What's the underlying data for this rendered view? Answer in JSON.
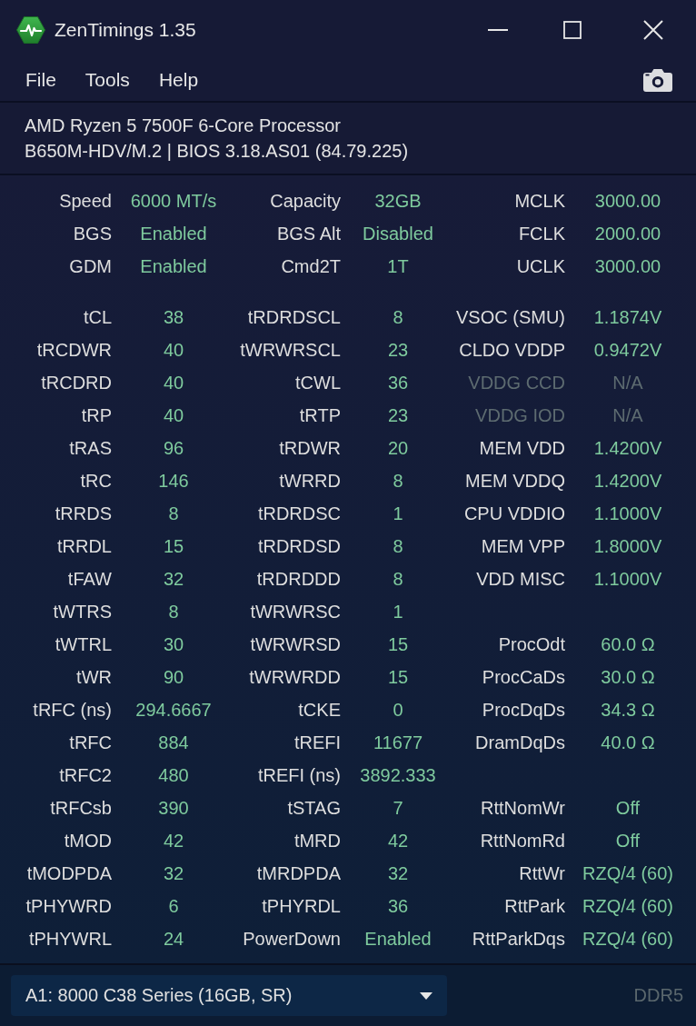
{
  "window": {
    "title": "ZenTimings 1.35"
  },
  "menu": [
    "File",
    "Tools",
    "Help"
  ],
  "system_info": {
    "processor": "AMD Ryzen 5 7500F 6-Core Processor",
    "board": "B650M-HDV/M.2 | BIOS 3.18.AS01 (84.79.225)"
  },
  "summary": {
    "columns": [
      {
        "items": [
          {
            "label": "Speed",
            "value": "6000 MT/s"
          },
          {
            "label": "BGS",
            "value": "Enabled"
          },
          {
            "label": "GDM",
            "value": "Enabled"
          }
        ]
      },
      {
        "items": [
          {
            "label": "Capacity",
            "value": "32GB"
          },
          {
            "label": "BGS Alt",
            "value": "Disabled"
          },
          {
            "label": "Cmd2T",
            "value": "1T"
          }
        ]
      },
      {
        "items": [
          {
            "label": "MCLK",
            "value": "3000.00"
          },
          {
            "label": "FCLK",
            "value": "2000.00"
          },
          {
            "label": "UCLK",
            "value": "3000.00"
          }
        ]
      }
    ]
  },
  "timings": {
    "columns": [
      {
        "groups": [
          {
            "items": [
              {
                "label": "tCL",
                "value": "38",
                "disabled": false
              },
              {
                "label": "tRCDWR",
                "value": "40",
                "disabled": false
              },
              {
                "label": "tRCDRD",
                "value": "40",
                "disabled": false
              },
              {
                "label": "tRP",
                "value": "40",
                "disabled": false
              },
              {
                "label": "tRAS",
                "value": "96",
                "disabled": false
              },
              {
                "label": "tRC",
                "value": "146",
                "disabled": false
              },
              {
                "label": "tRRDS",
                "value": "8",
                "disabled": false
              },
              {
                "label": "tRRDL",
                "value": "15",
                "disabled": false
              },
              {
                "label": "tFAW",
                "value": "32",
                "disabled": false
              },
              {
                "label": "tWTRS",
                "value": "8",
                "disabled": false
              },
              {
                "label": "tWTRL",
                "value": "30",
                "disabled": false
              },
              {
                "label": "tWR",
                "value": "90",
                "disabled": false
              },
              {
                "label": "tRFC (ns)",
                "value": "294.6667",
                "disabled": false
              },
              {
                "label": "tRFC",
                "value": "884",
                "disabled": false
              },
              {
                "label": "tRFC2",
                "value": "480",
                "disabled": false
              },
              {
                "label": "tRFCsb",
                "value": "390",
                "disabled": false
              },
              {
                "label": "tMOD",
                "value": "42",
                "disabled": false
              },
              {
                "label": "tMODPDA",
                "value": "32",
                "disabled": false
              },
              {
                "label": "tPHYWRD",
                "value": "6",
                "disabled": false
              },
              {
                "label": "tPHYWRL",
                "value": "24",
                "disabled": false
              }
            ]
          }
        ]
      },
      {
        "groups": [
          {
            "items": [
              {
                "label": "tRDRDSCL",
                "value": "8",
                "disabled": false
              },
              {
                "label": "tWRWRSCL",
                "value": "23",
                "disabled": false
              },
              {
                "label": "tCWL",
                "value": "36",
                "disabled": false
              },
              {
                "label": "tRTP",
                "value": "23",
                "disabled": false
              },
              {
                "label": "tRDWR",
                "value": "20",
                "disabled": false
              },
              {
                "label": "tWRRD",
                "value": "8",
                "disabled": false
              },
              {
                "label": "tRDRDSC",
                "value": "1",
                "disabled": false
              },
              {
                "label": "tRDRDSD",
                "value": "8",
                "disabled": false
              },
              {
                "label": "tRDRDDD",
                "value": "8",
                "disabled": false
              },
              {
                "label": "tWRWRSC",
                "value": "1",
                "disabled": false
              },
              {
                "label": "tWRWRSD",
                "value": "15",
                "disabled": false
              },
              {
                "label": "tWRWRDD",
                "value": "15",
                "disabled": false
              },
              {
                "label": "tCKE",
                "value": "0",
                "disabled": false
              },
              {
                "label": "tREFI",
                "value": "11677",
                "disabled": false
              },
              {
                "label": "tREFI (ns)",
                "value": "3892.333",
                "disabled": false
              },
              {
                "label": "tSTAG",
                "value": "7",
                "disabled": false
              },
              {
                "label": "tMRD",
                "value": "42",
                "disabled": false
              },
              {
                "label": "tMRDPDA",
                "value": "32",
                "disabled": false
              },
              {
                "label": "tPHYRDL",
                "value": "36",
                "disabled": false
              },
              {
                "label": "PowerDown",
                "value": "Enabled",
                "disabled": false
              }
            ]
          }
        ]
      },
      {
        "groups": [
          {
            "items": [
              {
                "label": "VSOC (SMU)",
                "value": "1.1874V",
                "disabled": false
              },
              {
                "label": "CLDO VDDP",
                "value": "0.9472V",
                "disabled": false
              },
              {
                "label": "VDDG CCD",
                "value": "N/A",
                "disabled": true
              },
              {
                "label": "VDDG IOD",
                "value": "N/A",
                "disabled": true
              },
              {
                "label": "MEM VDD",
                "value": "1.4200V",
                "disabled": false
              },
              {
                "label": "MEM VDDQ",
                "value": "1.4200V",
                "disabled": false
              },
              {
                "label": "CPU VDDIO",
                "value": "1.1000V",
                "disabled": false
              },
              {
                "label": "MEM VPP",
                "value": "1.8000V",
                "disabled": false
              },
              {
                "label": "VDD MISC",
                "value": "1.1000V",
                "disabled": false
              }
            ]
          },
          {
            "items": [
              {
                "label": "ProcOdt",
                "value": "60.0 Ω",
                "disabled": false
              },
              {
                "label": "ProcCaDs",
                "value": "30.0 Ω",
                "disabled": false
              },
              {
                "label": "ProcDqDs",
                "value": "34.3 Ω",
                "disabled": false
              },
              {
                "label": "DramDqDs",
                "value": "40.0 Ω",
                "disabled": false
              }
            ]
          },
          {
            "items": [
              {
                "label": "RttNomWr",
                "value": "Off",
                "disabled": false
              },
              {
                "label": "RttNomRd",
                "value": "Off",
                "disabled": false
              },
              {
                "label": "RttWr",
                "value": "RZQ/4 (60)",
                "disabled": false
              },
              {
                "label": "RttPark",
                "value": "RZQ/4 (60)",
                "disabled": false
              },
              {
                "label": "RttParkDqs",
                "value": "RZQ/4 (60)",
                "disabled": false
              }
            ]
          }
        ]
      }
    ]
  },
  "footer": {
    "module_select": {
      "value": "A1: 8000 C38 Series (16GB, SR)"
    },
    "memory_type": "DDR5"
  }
}
